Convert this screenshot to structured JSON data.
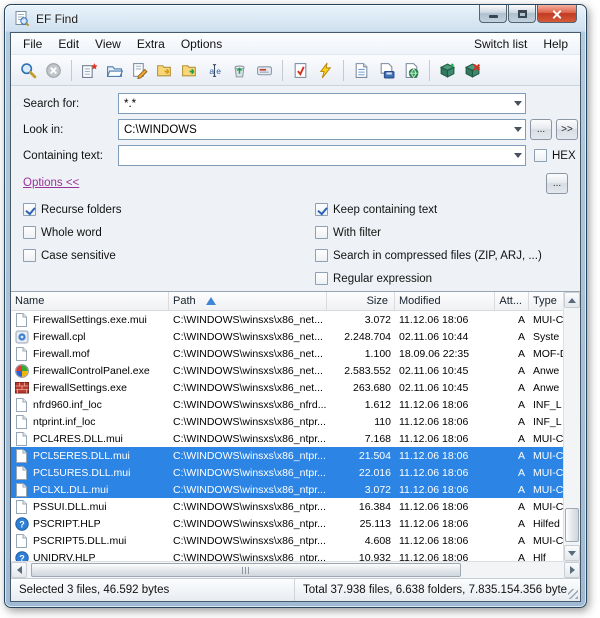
{
  "window": {
    "title": "EF Find"
  },
  "menu": {
    "left": [
      "File",
      "Edit",
      "View",
      "Extra",
      "Options"
    ],
    "right": [
      "Switch list",
      "Help"
    ]
  },
  "toolbar": {
    "groups": [
      [
        "search",
        "stop"
      ],
      [
        "new-search",
        "open",
        "edit",
        "copy",
        "move",
        "rename",
        "recycle-bin",
        "shortcut"
      ],
      [
        "checksum",
        "execute"
      ],
      [
        "report",
        "save",
        "web-export"
      ],
      [
        "install",
        "uninstall"
      ]
    ]
  },
  "search": {
    "search_for": {
      "label": "Search for:",
      "value": "*.*"
    },
    "look_in": {
      "label": "Look in:",
      "value": "C:\\WINDOWS",
      "browse_label": "...",
      "expand_label": ">>"
    },
    "containing_text": {
      "label": "Containing text:",
      "value": "",
      "hex_label": "HEX"
    }
  },
  "options": {
    "toggle_label": "Options  <<",
    "more_label": "...",
    "left": [
      {
        "label": "Recurse folders",
        "checked": true
      },
      {
        "label": "Whole word",
        "checked": false
      },
      {
        "label": "Case sensitive",
        "checked": false
      }
    ],
    "right": [
      {
        "label": "Keep containing text",
        "checked": true
      },
      {
        "label": "With filter",
        "checked": false
      },
      {
        "label": "Search in compressed files (ZIP, ARJ, ...)",
        "checked": false
      },
      {
        "label": "Regular expression",
        "checked": false
      }
    ]
  },
  "table": {
    "columns": [
      "Name",
      "Path",
      "Size",
      "Modified",
      "Att...",
      "Type"
    ],
    "sort": {
      "column": "Path",
      "direction": "asc"
    },
    "rows": [
      {
        "icon": "doc",
        "name": "FirewallSettings.exe.mui",
        "path": "C:\\WINDOWS\\winsxs\\x86_net...",
        "size": "3.072",
        "modified": "11.12.06 18:06",
        "attr": "A",
        "type": "MUI-C",
        "selected": false
      },
      {
        "icon": "cpl",
        "name": "Firewall.cpl",
        "path": "C:\\WINDOWS\\winsxs\\x86_net...",
        "size": "2.248.704",
        "modified": "02.11.06 10:44",
        "attr": "A",
        "type": "Syste",
        "selected": false
      },
      {
        "icon": "doc",
        "name": "Firewall.mof",
        "path": "C:\\WINDOWS\\winsxs\\x86_net...",
        "size": "1.100",
        "modified": "18.09.06 22:35",
        "attr": "A",
        "type": "MOF-D",
        "selected": false
      },
      {
        "icon": "winlogo",
        "name": "FirewallControlPanel.exe",
        "path": "C:\\WINDOWS\\winsxs\\x86_net...",
        "size": "2.583.552",
        "modified": "02.11.06 10:45",
        "attr": "A",
        "type": "Anwe",
        "selected": false
      },
      {
        "icon": "brick",
        "name": "FirewallSettings.exe",
        "path": "C:\\WINDOWS\\winsxs\\x86_net...",
        "size": "263.680",
        "modified": "02.11.06 10:45",
        "attr": "A",
        "type": "Anwe",
        "selected": false
      },
      {
        "icon": "doc",
        "name": "nfrd960.inf_loc",
        "path": "C:\\WINDOWS\\winsxs\\x86_nfrd...",
        "size": "1.612",
        "modified": "11.12.06 18:06",
        "attr": "A",
        "type": "INF_L",
        "selected": false
      },
      {
        "icon": "doc",
        "name": "ntprint.inf_loc",
        "path": "C:\\WINDOWS\\winsxs\\x86_ntpr...",
        "size": "110",
        "modified": "11.12.06 18:06",
        "attr": "A",
        "type": "INF_L",
        "selected": false
      },
      {
        "icon": "doc",
        "name": "PCL4RES.DLL.mui",
        "path": "C:\\WINDOWS\\winsxs\\x86_ntpr...",
        "size": "7.168",
        "modified": "11.12.06 18:06",
        "attr": "A",
        "type": "MUI-C",
        "selected": false
      },
      {
        "icon": "doc",
        "name": "PCL5ERES.DLL.mui",
        "path": "C:\\WINDOWS\\winsxs\\x86_ntpr...",
        "size": "21.504",
        "modified": "11.12.06 18:06",
        "attr": "A",
        "type": "MUI-C",
        "selected": true
      },
      {
        "icon": "doc",
        "name": "PCL5URES.DLL.mui",
        "path": "C:\\WINDOWS\\winsxs\\x86_ntpr...",
        "size": "22.016",
        "modified": "11.12.06 18:06",
        "attr": "A",
        "type": "MUI-C",
        "selected": true
      },
      {
        "icon": "doc",
        "name": "PCLXL.DLL.mui",
        "path": "C:\\WINDOWS\\winsxs\\x86_ntpr...",
        "size": "3.072",
        "modified": "11.12.06 18:06",
        "attr": "A",
        "type": "MUI-C",
        "selected": true
      },
      {
        "icon": "doc",
        "name": "PSSUI.DLL.mui",
        "path": "C:\\WINDOWS\\winsxs\\x86_ntpr...",
        "size": "16.384",
        "modified": "11.12.06 18:06",
        "attr": "A",
        "type": "MUI-C",
        "selected": false
      },
      {
        "icon": "help",
        "name": "PSCRIPT.HLP",
        "path": "C:\\WINDOWS\\winsxs\\x86_ntpr...",
        "size": "25.113",
        "modified": "11.12.06 18:06",
        "attr": "A",
        "type": "Hilfed",
        "selected": false
      },
      {
        "icon": "doc",
        "name": "PSCRIPT5.DLL.mui",
        "path": "C:\\WINDOWS\\winsxs\\x86_ntpr...",
        "size": "4.608",
        "modified": "11.12.06 18:06",
        "attr": "A",
        "type": "MUI-C",
        "selected": false
      },
      {
        "icon": "help",
        "name": "UNIDRV.HLP",
        "path": "C:\\WINDOWS\\winsxs\\x86_ntpr...",
        "size": "10.932",
        "modified": "11.12.06 18:06",
        "attr": "A",
        "type": "Hlf",
        "selected": false
      }
    ]
  },
  "status": {
    "selected": "Selected 3 files, 46.592 bytes",
    "total": "Total 37.938 files, 6.638 folders, 7.835.154.356 byte"
  },
  "colors": {
    "selection": "#2c84e4",
    "selection_text": "#ffffff",
    "options_link": "#993399",
    "sort_arrow": "#3f86d8"
  }
}
